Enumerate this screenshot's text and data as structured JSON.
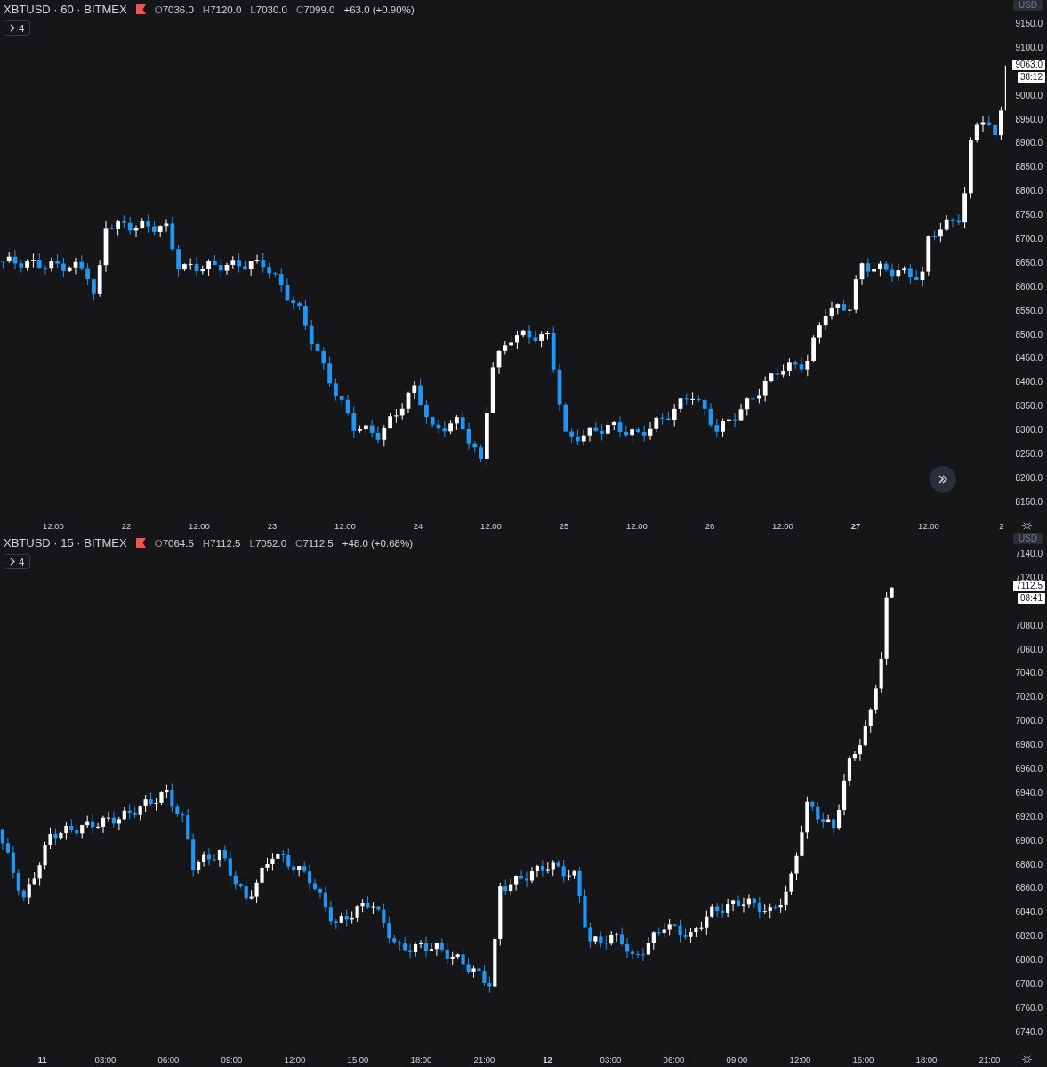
{
  "charts": [
    {
      "title": "XBTUSD · 60 · BITMEX",
      "ohlc": [
        {
          "label": "O",
          "value": "7036.0"
        },
        {
          "label": "H",
          "value": "7120.0"
        },
        {
          "label": "L",
          "value": "7030.0"
        },
        {
          "label": "C",
          "value": "7099.0"
        }
      ],
      "change": "+63.0 (+0.90%)",
      "indicator_count": "4",
      "currency": "USD",
      "last_price": "9063.0",
      "countdown": "38:12",
      "show_scroll_button": true,
      "price_ticks": [
        "9150.0",
        "9100.0",
        "9000.0",
        "8950.0",
        "8900.0",
        "8850.0",
        "8800.0",
        "8750.0",
        "8700.0",
        "8650.0",
        "8600.0",
        "8550.0",
        "8500.0",
        "8450.0",
        "8400.0",
        "8350.0",
        "8300.0",
        "8250.0",
        "8200.0",
        "8150.0"
      ],
      "time_ticks": [
        {
          "label": "12:00",
          "bold": false
        },
        {
          "label": "22",
          "bold": false
        },
        {
          "label": "12:00",
          "bold": false
        },
        {
          "label": "23",
          "bold": false
        },
        {
          "label": "12:00",
          "bold": false
        },
        {
          "label": "24",
          "bold": false
        },
        {
          "label": "12:00",
          "bold": false
        },
        {
          "label": "25",
          "bold": false
        },
        {
          "label": "12:00",
          "bold": false
        },
        {
          "label": "26",
          "bold": false
        },
        {
          "label": "12:00",
          "bold": false
        },
        {
          "label": "27",
          "bold": true
        },
        {
          "label": "12:00",
          "bold": false
        },
        {
          "label": "2",
          "bold": false
        }
      ]
    },
    {
      "title": "XBTUSD · 15 · BITMEX",
      "ohlc": [
        {
          "label": "O",
          "value": "7064.5"
        },
        {
          "label": "H",
          "value": "7112.5"
        },
        {
          "label": "L",
          "value": "7052.0"
        },
        {
          "label": "C",
          "value": "7112.5"
        }
      ],
      "change": "+48.0 (+0.68%)",
      "indicator_count": "4",
      "currency": "USD",
      "last_price": "7112.5",
      "countdown": "08:41",
      "show_scroll_button": false,
      "price_ticks": [
        "7140.0",
        "7120.0",
        "7080.0",
        "7060.0",
        "7040.0",
        "7020.0",
        "7000.0",
        "6980.0",
        "6960.0",
        "6940.0",
        "6920.0",
        "6900.0",
        "6880.0",
        "6860.0",
        "6840.0",
        "6820.0",
        "6800.0",
        "6780.0",
        "6760.0",
        "6740.0"
      ],
      "time_ticks": [
        {
          "label": "11",
          "bold": true
        },
        {
          "label": "03:00",
          "bold": false
        },
        {
          "label": "06:00",
          "bold": false
        },
        {
          "label": "09:00",
          "bold": false
        },
        {
          "label": "12:00",
          "bold": false
        },
        {
          "label": "15:00",
          "bold": false
        },
        {
          "label": "18:00",
          "bold": false
        },
        {
          "label": "21:00",
          "bold": false
        },
        {
          "label": "12",
          "bold": true
        },
        {
          "label": "03:00",
          "bold": false
        },
        {
          "label": "06:00",
          "bold": false
        },
        {
          "label": "09:00",
          "bold": false
        },
        {
          "label": "12:00",
          "bold": false
        },
        {
          "label": "15:00",
          "bold": false
        },
        {
          "label": "18:00",
          "bold": false
        },
        {
          "label": "21:00",
          "bold": false
        }
      ]
    }
  ]
}
